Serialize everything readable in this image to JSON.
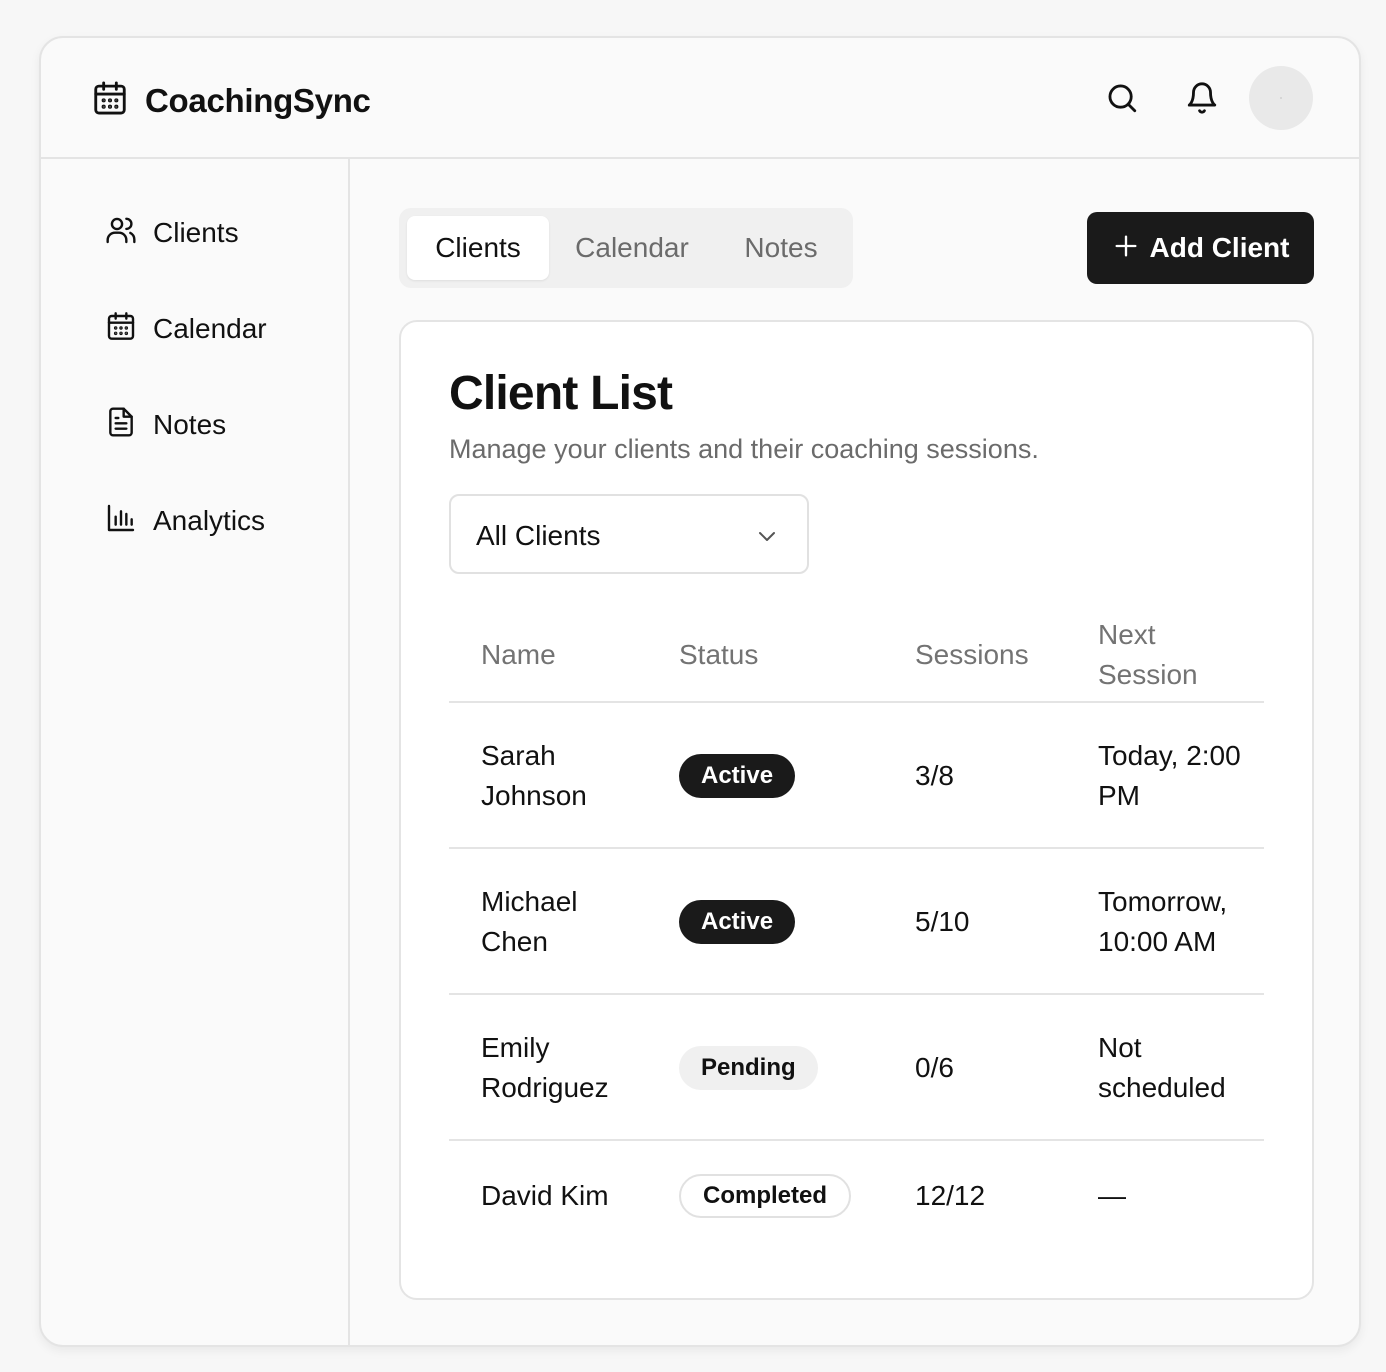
{
  "app": {
    "name": "CoachingSync"
  },
  "header": {
    "icons": [
      "calendar-icon",
      "search-icon",
      "bell-icon"
    ]
  },
  "sidebar": {
    "items": [
      {
        "label": "Clients",
        "icon": "users-icon"
      },
      {
        "label": "Calendar",
        "icon": "calendar-icon"
      },
      {
        "label": "Notes",
        "icon": "file-text-icon"
      },
      {
        "label": "Analytics",
        "icon": "bar-chart-icon"
      }
    ]
  },
  "tabs": [
    {
      "label": "Clients",
      "active": true
    },
    {
      "label": "Calendar",
      "active": false
    },
    {
      "label": "Notes",
      "active": false
    }
  ],
  "actions": {
    "add_client_label": "Add Client"
  },
  "card": {
    "title": "Client List",
    "subtitle": "Manage your clients and their coaching sessions.",
    "filter": {
      "selected": "All Clients"
    }
  },
  "table": {
    "columns": [
      "Name",
      "Status",
      "Sessions",
      "Next Session"
    ],
    "rows": [
      {
        "name": "Sarah Johnson",
        "status": "Active",
        "sessions": "3/8",
        "next": "Today, 2:00 PM"
      },
      {
        "name": "Michael Chen",
        "status": "Active",
        "sessions": "5/10",
        "next": "Tomorrow, 10:00 AM"
      },
      {
        "name": "Emily Rodriguez",
        "status": "Pending",
        "sessions": "0/6",
        "next": "Not scheduled"
      },
      {
        "name": "David Kim",
        "status": "Completed",
        "sessions": "12/12",
        "next": "—"
      }
    ]
  },
  "colors": {
    "accent": "#1a1a1a",
    "border": "#e4e4e4",
    "muted_text": "#6b6b6b"
  }
}
